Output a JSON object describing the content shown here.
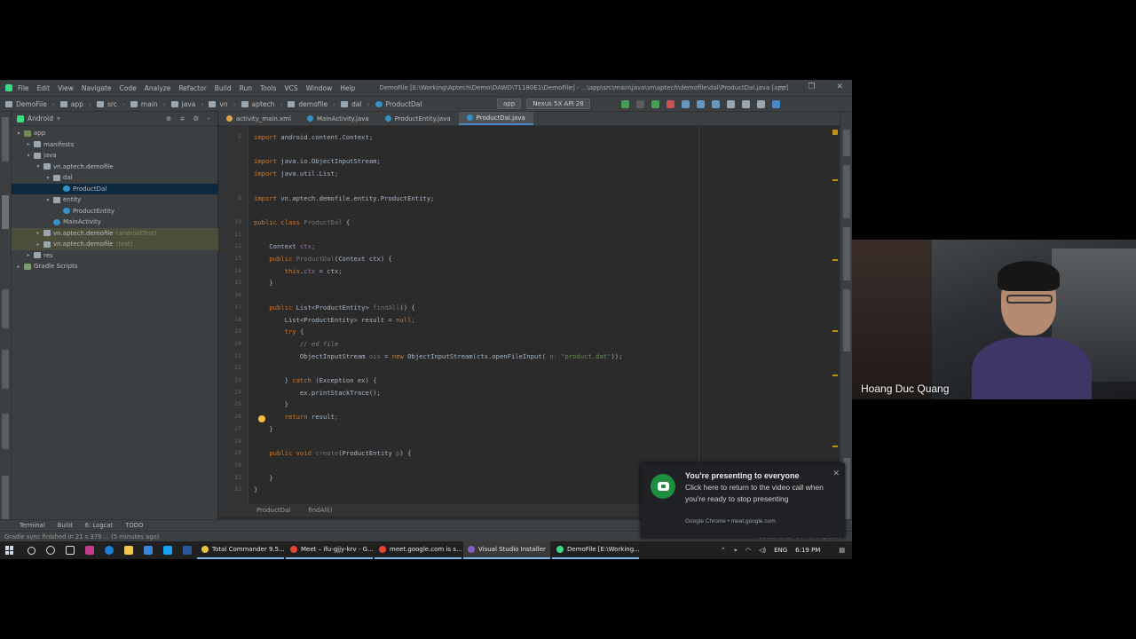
{
  "ide": {
    "app_name": "DemoFile",
    "window_title": "DemoFile [E:\\Working\\Aptech\\Demo\\DAWD\\T1180E1\\DemoFile] - ...\\app\\src\\main\\java\\vn\\aptech\\demofile\\dal\\ProductDal.java [app]",
    "menu": [
      "File",
      "Edit",
      "View",
      "Navigate",
      "Code",
      "Analyze",
      "Refactor",
      "Build",
      "Run",
      "Tools",
      "VCS",
      "Window",
      "Help"
    ],
    "breadcrumbs": [
      "DemoFile",
      "app",
      "src",
      "main",
      "java",
      "vn",
      "aptech",
      "demofile",
      "dal",
      "ProductDal"
    ],
    "run_config": "app",
    "device": "Nexus 5X API 28",
    "project_view_label": "Android",
    "tree": [
      {
        "label": "app",
        "depth": 0,
        "arrow": "▾",
        "icon_color": "#6b8e5a"
      },
      {
        "label": "manifests",
        "depth": 1,
        "arrow": "▸",
        "icon_color": "#9aa7b0"
      },
      {
        "label": "java",
        "depth": 1,
        "arrow": "▾",
        "icon_color": "#9aa7b0"
      },
      {
        "label": "vn.aptech.demofile",
        "depth": 2,
        "arrow": "▾",
        "icon_color": "#9aa7b0"
      },
      {
        "label": "dal",
        "depth": 3,
        "arrow": "▾",
        "icon_color": "#9aa7b0"
      },
      {
        "label": "ProductDal",
        "depth": 4,
        "arrow": "",
        "icon_color": "#3592c4",
        "selected": true
      },
      {
        "label": "entity",
        "depth": 3,
        "arrow": "▾",
        "icon_color": "#9aa7b0"
      },
      {
        "label": "ProductEntity",
        "depth": 4,
        "arrow": "",
        "icon_color": "#3592c4"
      },
      {
        "label": "MainActivity",
        "depth": 3,
        "arrow": "",
        "icon_color": "#3592c4"
      },
      {
        "label": "vn.aptech.demofile",
        "depth": 2,
        "arrow": "▸",
        "icon_color": "#9aa7b0",
        "suffix": "(androidTest)",
        "highlight": true
      },
      {
        "label": "vn.aptech.demofile",
        "depth": 2,
        "arrow": "▸",
        "icon_color": "#9aa7b0",
        "suffix": "(test)",
        "highlight": true
      },
      {
        "label": "res",
        "depth": 1,
        "arrow": "▸",
        "icon_color": "#9aa7b0"
      },
      {
        "label": "Gradle Scripts",
        "depth": 0,
        "arrow": "▸",
        "icon_color": "#7d9a6e"
      }
    ],
    "tabs": [
      {
        "label": "activity_main.xml",
        "color": "#e0a24a",
        "active": false
      },
      {
        "label": "MainActivity.java",
        "color": "#3592c4",
        "active": false
      },
      {
        "label": "ProductEntity.java",
        "color": "#3592c4",
        "active": false
      },
      {
        "label": "ProductDal.java",
        "color": "#3592c4",
        "active": true
      }
    ],
    "code_lines": [
      {
        "n": "5",
        "html_segments": [
          {
            "t": "import ",
            "c": "kw"
          },
          {
            "t": "android.content.Context;",
            "c": "cls"
          }
        ]
      },
      {
        "n": "",
        "html_segments": []
      },
      {
        "n": "",
        "html_segments": [
          {
            "t": "import ",
            "c": "kw"
          },
          {
            "t": "java.io.ObjectInputStream;",
            "c": "cls"
          }
        ]
      },
      {
        "n": "",
        "html_segments": [
          {
            "t": "import ",
            "c": "kw"
          },
          {
            "t": "java.util.List;",
            "c": "cls"
          }
        ]
      },
      {
        "n": "",
        "html_segments": []
      },
      {
        "n": "8",
        "html_segments": [
          {
            "t": "import ",
            "c": "kw"
          },
          {
            "t": "vn.aptech.demofile.entity.ProductEntity;",
            "c": "cls"
          }
        ]
      },
      {
        "n": "",
        "html_segments": []
      },
      {
        "n": "10",
        "html_segments": [
          {
            "t": "public class ",
            "c": "kw"
          },
          {
            "t": "ProductDal",
            "c": "unused"
          },
          {
            "t": " {",
            "c": "cls"
          }
        ]
      },
      {
        "n": "11",
        "html_segments": []
      },
      {
        "n": "12",
        "html_segments": [
          {
            "t": "    Context ",
            "c": "cls"
          },
          {
            "t": "ctx",
            "c": "fld"
          },
          {
            "t": ";",
            "c": "kw"
          }
        ]
      },
      {
        "n": "13",
        "html_segments": [
          {
            "t": "    public ",
            "c": "kw"
          },
          {
            "t": "ProductDal",
            "c": "unused"
          },
          {
            "t": "(Context ctx) {",
            "c": "cls"
          }
        ]
      },
      {
        "n": "14",
        "html_segments": [
          {
            "t": "        this",
            "c": "kw"
          },
          {
            "t": ".",
            "c": "cls"
          },
          {
            "t": "ctx",
            "c": "fld"
          },
          {
            "t": " = ctx;",
            "c": "cls"
          }
        ]
      },
      {
        "n": "15",
        "html_segments": [
          {
            "t": "    }",
            "c": "cls"
          }
        ]
      },
      {
        "n": "16",
        "html_segments": []
      },
      {
        "n": "17",
        "html_segments": [
          {
            "t": "    public ",
            "c": "kw"
          },
          {
            "t": "List<ProductEntity> ",
            "c": "cls"
          },
          {
            "t": "findAll",
            "c": "unused"
          },
          {
            "t": "() {",
            "c": "cls"
          }
        ]
      },
      {
        "n": "18",
        "html_segments": [
          {
            "t": "        List<ProductEntity> result = ",
            "c": "cls"
          },
          {
            "t": "null",
            "c": "kw"
          },
          {
            "t": ";",
            "c": "kw"
          }
        ]
      },
      {
        "n": "19",
        "html_segments": [
          {
            "t": "        try ",
            "c": "kw"
          },
          {
            "t": "{",
            "c": "cls"
          }
        ]
      },
      {
        "n": "20",
        "html_segments": [
          {
            "t": "            // ed file",
            "c": "cmt"
          }
        ]
      },
      {
        "n": "21",
        "html_segments": [
          {
            "t": "            ObjectInputStream ",
            "c": "cls"
          },
          {
            "t": "ois",
            "c": "unused"
          },
          {
            "t": " = ",
            "c": "cls"
          },
          {
            "t": "new ",
            "c": "kw"
          },
          {
            "t": "ObjectInputStream(ctx.openFileInput( ",
            "c": "cls"
          },
          {
            "t": "n: ",
            "c": "unused"
          },
          {
            "t": "\"product.dat\"",
            "c": "str"
          },
          {
            "t": "));",
            "c": "cls"
          }
        ]
      },
      {
        "n": "22",
        "html_segments": []
      },
      {
        "n": "23",
        "html_segments": [
          {
            "t": "        } ",
            "c": "cls"
          },
          {
            "t": "catch ",
            "c": "kw"
          },
          {
            "t": "(Exception ex) {",
            "c": "cls"
          }
        ]
      },
      {
        "n": "24",
        "html_segments": [
          {
            "t": "            ex.printStackTrace();",
            "c": "cls"
          }
        ]
      },
      {
        "n": "25",
        "html_segments": [
          {
            "t": "        }",
            "c": "cls"
          }
        ]
      },
      {
        "n": "26",
        "html_segments": [
          {
            "t": "        return ",
            "c": "kw"
          },
          {
            "t": "result",
            "c": "cls"
          },
          {
            "t": ";",
            "c": "kw"
          }
        ]
      },
      {
        "n": "27",
        "html_segments": [
          {
            "t": "    }",
            "c": "cls"
          }
        ]
      },
      {
        "n": "28",
        "html_segments": []
      },
      {
        "n": "29",
        "html_segments": [
          {
            "t": "    public void ",
            "c": "kw"
          },
          {
            "t": "create",
            "c": "unused"
          },
          {
            "t": "(ProductEntity ",
            "c": "cls"
          },
          {
            "t": "p",
            "c": "unused"
          },
          {
            "t": ") {",
            "c": "cls"
          }
        ]
      },
      {
        "n": "30",
        "html_segments": []
      },
      {
        "n": "31",
        "html_segments": [
          {
            "t": "    }",
            "c": "cls"
          }
        ]
      },
      {
        "n": "32",
        "html_segments": [
          {
            "t": "}",
            "c": "cls"
          }
        ]
      }
    ],
    "editor_breadcrumb": [
      "ProductDal",
      "findAll()"
    ],
    "bottom_tools": [
      "Terminal",
      "Build",
      "6: Logcat",
      "TODO"
    ],
    "status_text": "Gradle sync finished in 21 s 379 ... (5 minutes ago)",
    "status_right": "20:23  CRLF  UTF-8  4 spaces"
  },
  "taskbar": {
    "tasks": [
      {
        "label": "Total Commander 9.5...",
        "color": "#e8c34a",
        "active": false
      },
      {
        "label": "Meet – ifu-gjjy-krv - G...",
        "color": "#e94235",
        "active": false
      },
      {
        "label": "meet.google.com is s...",
        "color": "#e94235",
        "active": false
      },
      {
        "label": "Visual Studio Installer",
        "color": "#865fc5",
        "active": true
      },
      {
        "label": "DemoFile [E:\\Working...",
        "color": "#3ddc84",
        "active": false
      }
    ],
    "lang": "ENG",
    "time": "6:19 PM"
  },
  "toast": {
    "title": "You're presenting to everyone",
    "body": "Click here to return to the video call when you're ready to stop presenting",
    "footer": "Google Chrome • meet.google.com"
  },
  "video": {
    "participant_name": "Hoang Duc Quang"
  }
}
